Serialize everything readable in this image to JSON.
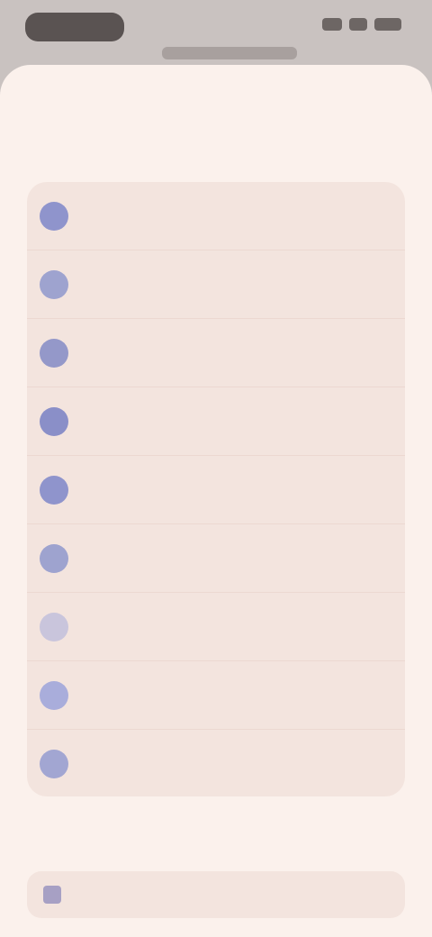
{
  "status_bar": {
    "time": "",
    "icons": [
      "signal-icon",
      "wifi-icon",
      "battery-icon"
    ]
  },
  "header": {
    "secondary_action": "",
    "primary_action": ""
  },
  "list": {
    "items": [
      {
        "label": "",
        "avatar_color": "#8f94cc"
      },
      {
        "label": "",
        "avatar_color": "#9ea3cf"
      },
      {
        "label": "",
        "avatar_color": "#9498c9"
      },
      {
        "label": "",
        "avatar_color": "#8a8fc8"
      },
      {
        "label": "",
        "avatar_color": "#8f94cc"
      },
      {
        "label": "",
        "avatar_color": "#9ea3cf"
      },
      {
        "label": "",
        "avatar_color": "#c9c5dc"
      },
      {
        "label": "",
        "avatar_color": "#a9addb"
      },
      {
        "label": "",
        "avatar_color": "#a2a6d2"
      }
    ]
  },
  "section": {
    "heading": "",
    "row_label": ""
  },
  "colors": {
    "sheet_background": "#fbf1ec",
    "card_background": "#f3e4de",
    "accent": "#8f94cc"
  }
}
